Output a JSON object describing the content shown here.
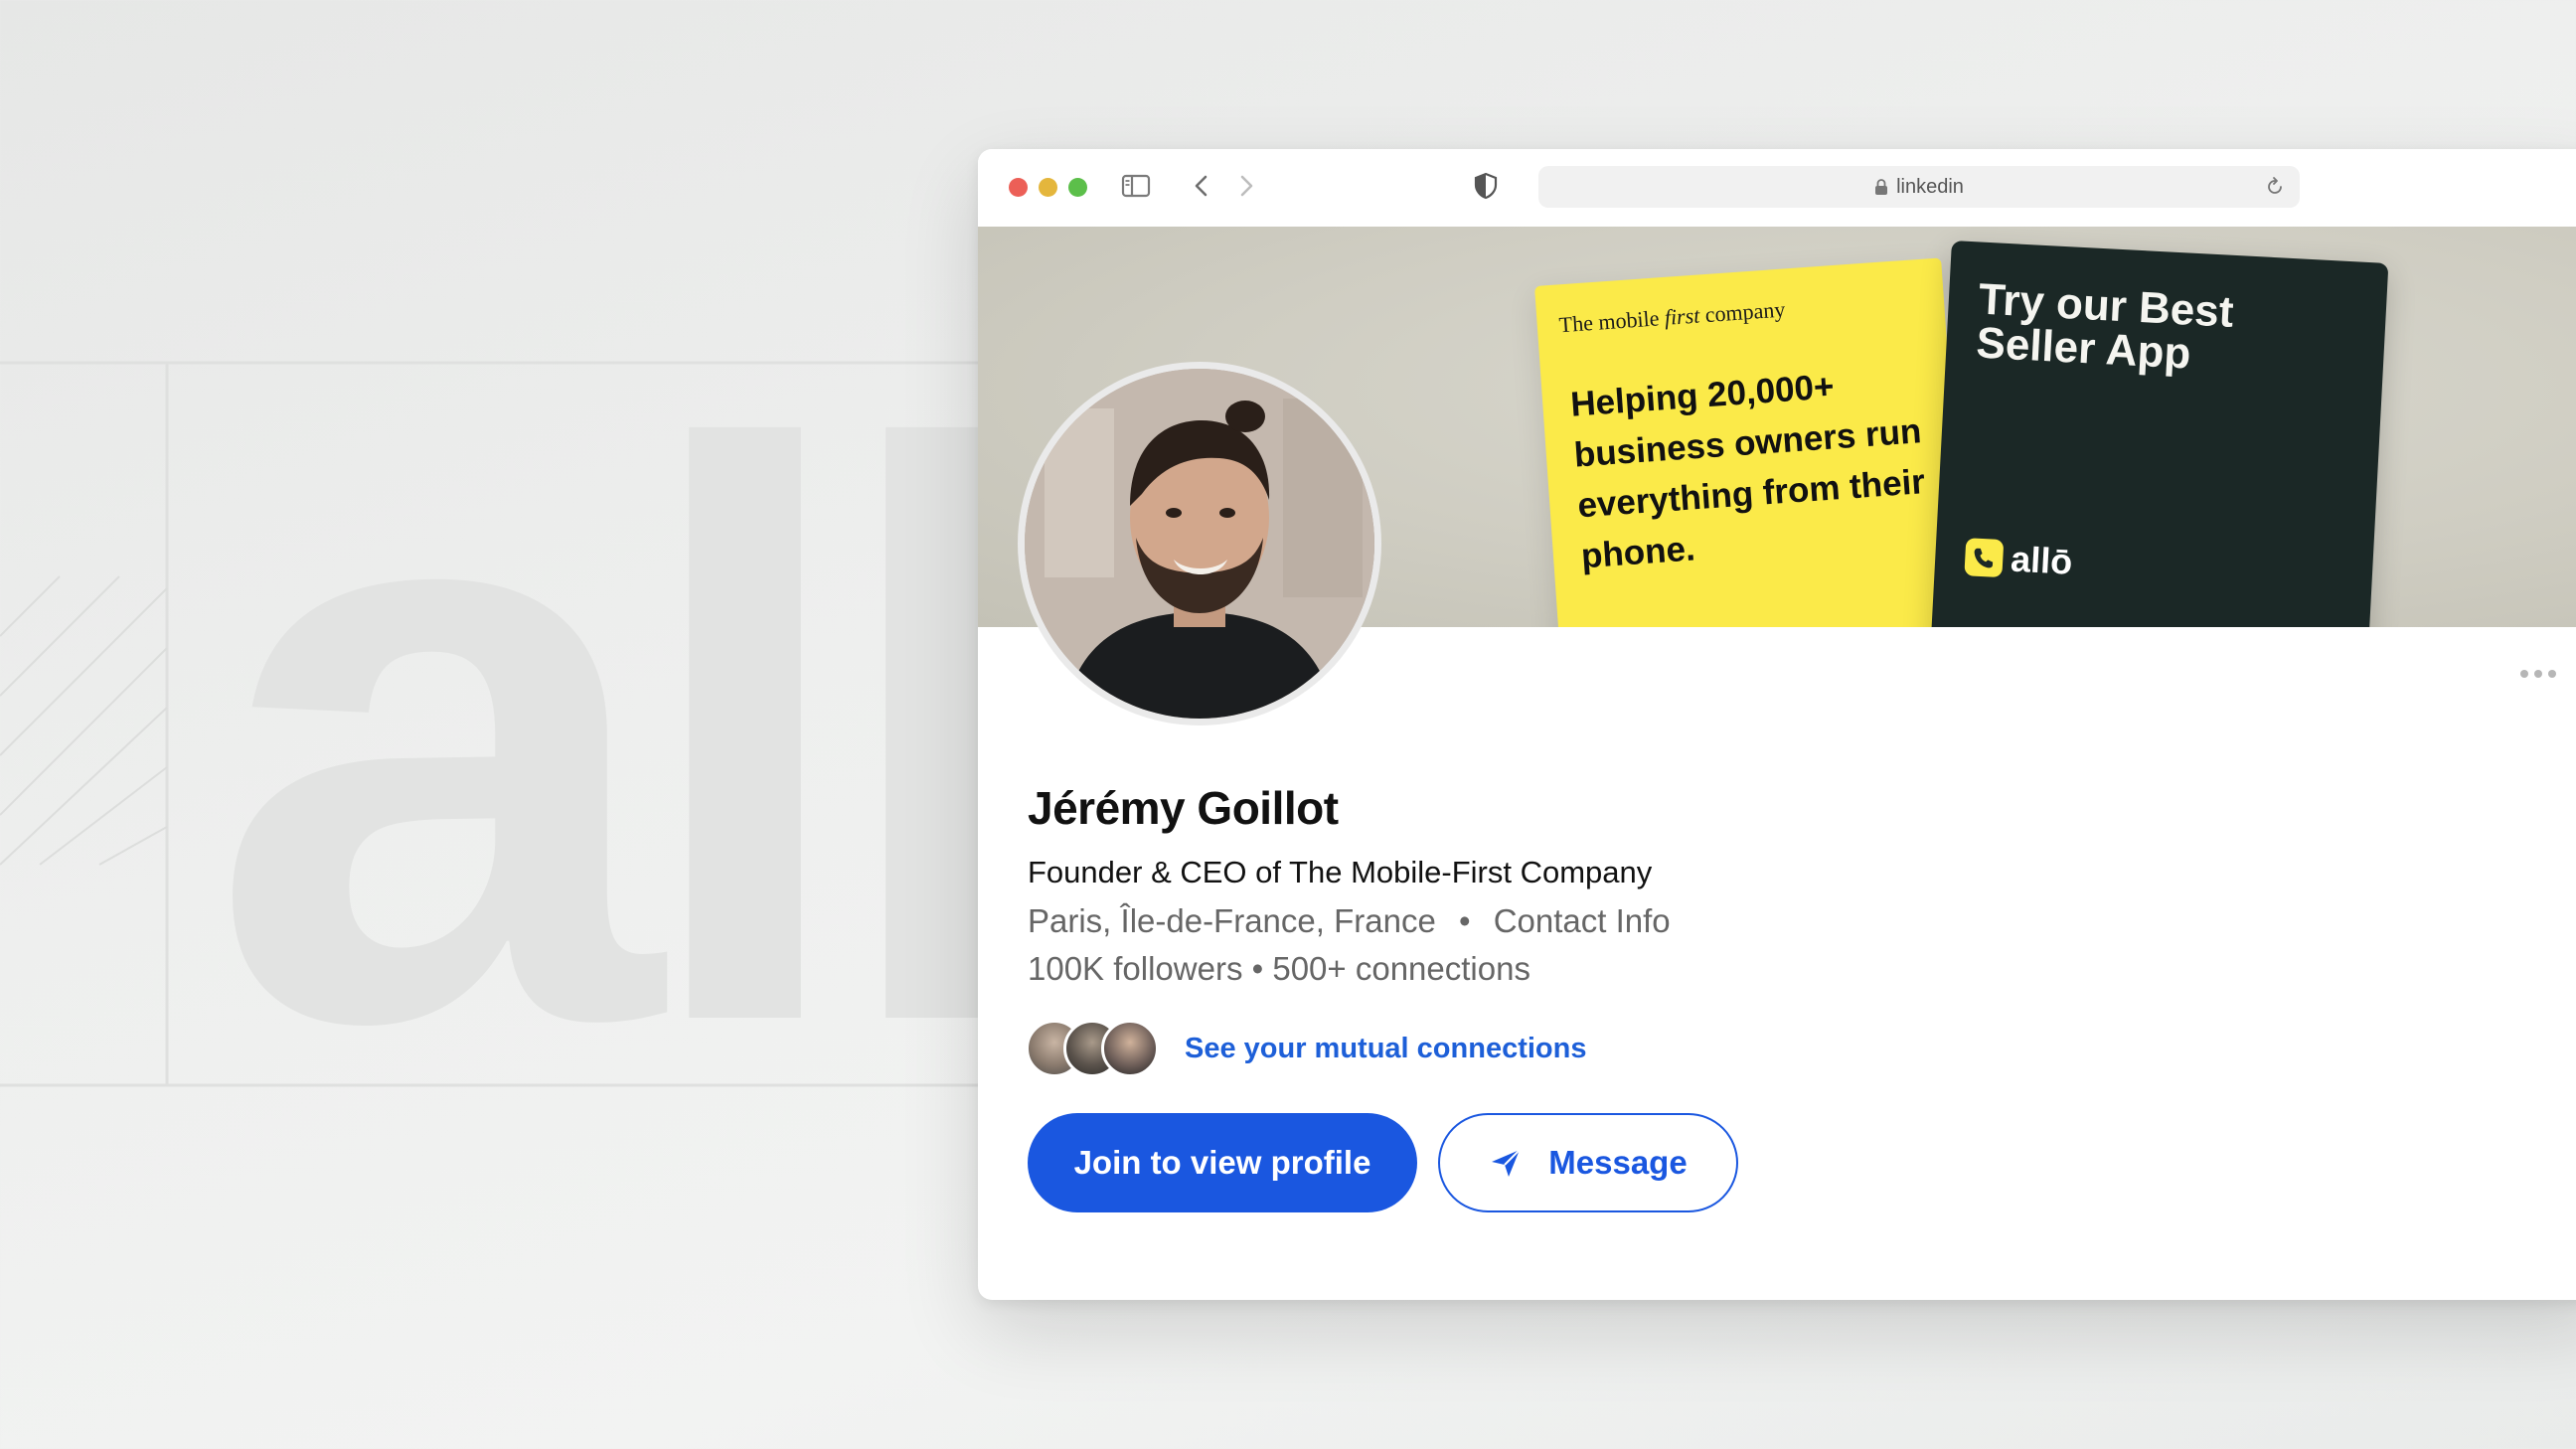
{
  "browser": {
    "url": "linkedin"
  },
  "banner": {
    "yellow_card": {
      "tag_pre": "The mobile ",
      "tag_italic": "first",
      "tag_post": " company",
      "headline": "Helping 20,000+ business owners run everything from their phone."
    },
    "dark_card": {
      "title": "Try our Best Seller App",
      "brand": "allō"
    }
  },
  "profile": {
    "name": "Jérémy Goillot",
    "headline": "Founder & CEO of The Mobile-First Company",
    "location": "Paris, Île-de-France, France",
    "separator": "•",
    "contact_info": "Contact Info",
    "stats": "100K followers • 500+ connections",
    "mutual_link": "See your mutual connections"
  },
  "actions": {
    "join_label": "Join to view profile",
    "message_label": "Message"
  },
  "background": {
    "logo_text": "all"
  },
  "colors": {
    "primary": "#1a57e0",
    "yellow": "#fbea49",
    "dark_card": "#1b2826"
  }
}
